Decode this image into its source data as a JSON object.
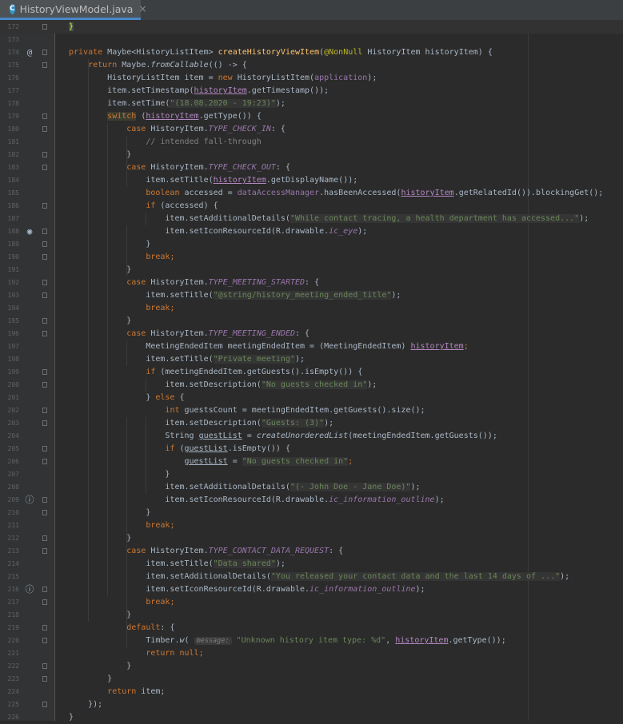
{
  "tab": {
    "icon_letter": "C",
    "title": "HistoryViewModel.java",
    "close": "×"
  },
  "lines": [
    {
      "n": "172",
      "tokens": [
        {
          "t": "}",
          "c": "brace-hl"
        }
      ]
    },
    {
      "n": "173",
      "tokens": []
    },
    {
      "n": "174",
      "marker": "@",
      "tokens": [
        {
          "t": "private ",
          "c": "k"
        },
        {
          "t": "Maybe<HistoryListItem> "
        },
        {
          "t": "createHistoryViewItem",
          "c": "m"
        },
        {
          "t": "("
        },
        {
          "t": "@NonNull ",
          "c": "an"
        },
        {
          "t": "HistoryItem historyItem) {"
        }
      ]
    },
    {
      "n": "175",
      "tokens": [
        {
          "t": "    "
        },
        {
          "t": "return ",
          "c": "k"
        },
        {
          "t": "Maybe."
        },
        {
          "t": "fromCallable",
          "c": "i"
        },
        {
          "t": "(() -> {"
        }
      ]
    },
    {
      "n": "176",
      "tokens": [
        {
          "t": "        HistoryListItem item = "
        },
        {
          "t": "new ",
          "c": "k"
        },
        {
          "t": "HistoryListItem("
        },
        {
          "t": "application",
          "c": "p"
        },
        {
          "t": ");"
        }
      ]
    },
    {
      "n": "177",
      "tokens": [
        {
          "t": "        item.setTimestamp("
        },
        {
          "t": "historyItem",
          "c": "uv"
        },
        {
          "t": ".getTimestamp());"
        }
      ]
    },
    {
      "n": "178",
      "tokens": [
        {
          "t": "        item.setTime("
        },
        {
          "t": "\"(18.08.2020 - 19:23)\"",
          "c": "s-hl"
        },
        {
          "t": ");"
        }
      ]
    },
    {
      "n": "179",
      "tokens": [
        {
          "t": "        "
        },
        {
          "t": "switch",
          "c": "k sw"
        },
        {
          "t": " ("
        },
        {
          "t": "historyItem",
          "c": "uv"
        },
        {
          "t": ".getType()) {"
        }
      ]
    },
    {
      "n": "180",
      "tokens": [
        {
          "t": "            "
        },
        {
          "t": "case ",
          "c": "k"
        },
        {
          "t": "HistoryItem."
        },
        {
          "t": "TYPE_CHECK_IN",
          "c": "p i"
        },
        {
          "t": ": {"
        }
      ]
    },
    {
      "n": "181",
      "tokens": [
        {
          "t": "                "
        },
        {
          "t": "// intended fall-through",
          "c": "cm"
        }
      ]
    },
    {
      "n": "182",
      "tokens": [
        {
          "t": "            }"
        }
      ]
    },
    {
      "n": "183",
      "tokens": [
        {
          "t": "            "
        },
        {
          "t": "case ",
          "c": "k"
        },
        {
          "t": "HistoryItem."
        },
        {
          "t": "TYPE_CHECK_OUT",
          "c": "p i"
        },
        {
          "t": ": {"
        }
      ]
    },
    {
      "n": "184",
      "tokens": [
        {
          "t": "                item.setTitle("
        },
        {
          "t": "historyItem",
          "c": "uv"
        },
        {
          "t": ".getDisplayName());"
        }
      ]
    },
    {
      "n": "185",
      "tokens": [
        {
          "t": "                "
        },
        {
          "t": "boolean ",
          "c": "k"
        },
        {
          "t": "accessed = "
        },
        {
          "t": "dataAccessManager",
          "c": "p"
        },
        {
          "t": ".hasBeenAccessed("
        },
        {
          "t": "historyItem",
          "c": "uv"
        },
        {
          "t": ".getRelatedId()).blockingGet();"
        }
      ]
    },
    {
      "n": "186",
      "tokens": [
        {
          "t": "                "
        },
        {
          "t": "if ",
          "c": "k"
        },
        {
          "t": "(accessed) {"
        }
      ]
    },
    {
      "n": "187",
      "tokens": [
        {
          "t": "                    item.setAdditionalDetails("
        },
        {
          "t": "\"While contact tracing, a health department has accessed...\"",
          "c": "s-hl"
        },
        {
          "t": ");"
        }
      ]
    },
    {
      "n": "188",
      "marker": "👁",
      "tokens": [
        {
          "t": "                    item.setIconResourceId(R.drawable."
        },
        {
          "t": "ic_eye",
          "c": "p i"
        },
        {
          "t": ");"
        }
      ]
    },
    {
      "n": "189",
      "tokens": [
        {
          "t": "                }"
        }
      ]
    },
    {
      "n": "190",
      "tokens": [
        {
          "t": "                "
        },
        {
          "t": "break",
          "c": "k"
        },
        {
          "t": ";",
          "c": "k"
        }
      ]
    },
    {
      "n": "191",
      "tokens": [
        {
          "t": "            }"
        }
      ]
    },
    {
      "n": "192",
      "tokens": [
        {
          "t": "            "
        },
        {
          "t": "case ",
          "c": "k"
        },
        {
          "t": "HistoryItem."
        },
        {
          "t": "TYPE_MEETING_STARTED",
          "c": "p i"
        },
        {
          "t": ": {"
        }
      ]
    },
    {
      "n": "193",
      "tokens": [
        {
          "t": "                item.setTitle("
        },
        {
          "t": "\"@string/history_meeting_ended_title\"",
          "c": "s-hl"
        },
        {
          "t": ");"
        }
      ]
    },
    {
      "n": "194",
      "tokens": [
        {
          "t": "                "
        },
        {
          "t": "break",
          "c": "k"
        },
        {
          "t": ";",
          "c": "k"
        }
      ]
    },
    {
      "n": "195",
      "tokens": [
        {
          "t": "            }"
        }
      ]
    },
    {
      "n": "196",
      "tokens": [
        {
          "t": "            "
        },
        {
          "t": "case ",
          "c": "k"
        },
        {
          "t": "HistoryItem."
        },
        {
          "t": "TYPE_MEETING_ENDED",
          "c": "p i"
        },
        {
          "t": ": {"
        }
      ]
    },
    {
      "n": "197",
      "tokens": [
        {
          "t": "                MeetingEndedItem meetingEndedItem = (MeetingEndedItem) "
        },
        {
          "t": "historyItem",
          "c": "uv"
        },
        {
          "t": ";",
          "c": "k"
        }
      ]
    },
    {
      "n": "198",
      "tokens": [
        {
          "t": "                item.setTitle("
        },
        {
          "t": "\"Private meeting\"",
          "c": "s-hl"
        },
        {
          "t": ");"
        }
      ]
    },
    {
      "n": "199",
      "tokens": [
        {
          "t": "                "
        },
        {
          "t": "if ",
          "c": "k"
        },
        {
          "t": "(meetingEndedItem.getGuests().isEmpty()) {"
        }
      ]
    },
    {
      "n": "200",
      "tokens": [
        {
          "t": "                    item.setDescription("
        },
        {
          "t": "\"No guests checked in\"",
          "c": "s-hl"
        },
        {
          "t": ");"
        }
      ]
    },
    {
      "n": "201",
      "tokens": [
        {
          "t": "                } "
        },
        {
          "t": "else ",
          "c": "k"
        },
        {
          "t": "{"
        }
      ]
    },
    {
      "n": "202",
      "tokens": [
        {
          "t": "                    "
        },
        {
          "t": "int ",
          "c": "k"
        },
        {
          "t": "guestsCount = meetingEndedItem.getGuests().size();"
        }
      ]
    },
    {
      "n": "203",
      "tokens": [
        {
          "t": "                    item.setDescription("
        },
        {
          "t": "\"Guests: (3)\"",
          "c": "s-hl"
        },
        {
          "t": ");"
        }
      ]
    },
    {
      "n": "204",
      "tokens": [
        {
          "t": "                    String "
        },
        {
          "t": "guestList",
          "c": "u"
        },
        {
          "t": " = "
        },
        {
          "t": "createUnorderedList",
          "c": "i"
        },
        {
          "t": "(meetingEndedItem.getGuests());"
        }
      ]
    },
    {
      "n": "205",
      "tokens": [
        {
          "t": "                    "
        },
        {
          "t": "if ",
          "c": "k"
        },
        {
          "t": "("
        },
        {
          "t": "guestList",
          "c": "u"
        },
        {
          "t": ".isEmpty()) {"
        }
      ]
    },
    {
      "n": "206",
      "tokens": [
        {
          "t": "                        "
        },
        {
          "t": "guestList",
          "c": "u"
        },
        {
          "t": " = "
        },
        {
          "t": "\"No guests checked in\"",
          "c": "s-hl"
        },
        {
          "t": ";",
          "c": "k"
        }
      ]
    },
    {
      "n": "207",
      "tokens": [
        {
          "t": "                    }"
        }
      ]
    },
    {
      "n": "208",
      "tokens": [
        {
          "t": "                    item.setAdditionalDetails("
        },
        {
          "t": "\"(- John Doe - Jane Doe)\"",
          "c": "s-hl"
        },
        {
          "t": ");"
        }
      ]
    },
    {
      "n": "209",
      "marker": "ⓘ",
      "tokens": [
        {
          "t": "                    item.setIconResourceId(R.drawable."
        },
        {
          "t": "ic_information_outline",
          "c": "p i"
        },
        {
          "t": ");"
        }
      ]
    },
    {
      "n": "210",
      "tokens": [
        {
          "t": "                }"
        }
      ]
    },
    {
      "n": "211",
      "tokens": [
        {
          "t": "                "
        },
        {
          "t": "break",
          "c": "k"
        },
        {
          "t": ";",
          "c": "k"
        }
      ]
    },
    {
      "n": "212",
      "tokens": [
        {
          "t": "            }"
        }
      ]
    },
    {
      "n": "213",
      "tokens": [
        {
          "t": "            "
        },
        {
          "t": "case ",
          "c": "k"
        },
        {
          "t": "HistoryItem."
        },
        {
          "t": "TYPE_CONTACT_DATA_REQUEST",
          "c": "p i"
        },
        {
          "t": ": {"
        }
      ]
    },
    {
      "n": "214",
      "tokens": [
        {
          "t": "                item.setTitle("
        },
        {
          "t": "\"Data shared\"",
          "c": "s-hl"
        },
        {
          "t": ");"
        }
      ]
    },
    {
      "n": "215",
      "tokens": [
        {
          "t": "                item.setAdditionalDetails("
        },
        {
          "t": "\"You released your contact data and the last 14 days of ...\"",
          "c": "s-hl"
        },
        {
          "t": ");"
        }
      ]
    },
    {
      "n": "216",
      "marker": "ⓘ",
      "tokens": [
        {
          "t": "                item.setIconResourceId(R.drawable."
        },
        {
          "t": "ic_information_outline",
          "c": "p i"
        },
        {
          "t": ");"
        }
      ]
    },
    {
      "n": "217",
      "tokens": [
        {
          "t": "                "
        },
        {
          "t": "break",
          "c": "k"
        },
        {
          "t": ";",
          "c": "k"
        }
      ]
    },
    {
      "n": "218",
      "tokens": [
        {
          "t": "            }"
        }
      ]
    },
    {
      "n": "219",
      "tokens": [
        {
          "t": "            "
        },
        {
          "t": "default",
          "c": "k"
        },
        {
          "t": ": {"
        }
      ]
    },
    {
      "n": "220",
      "tokens": [
        {
          "t": "                Timber."
        },
        {
          "t": "w",
          "c": "i"
        },
        {
          "t": "( "
        },
        {
          "t": "message:",
          "c": "hint"
        },
        {
          "t": " "
        },
        {
          "t": "\"Unknown history item type: %d\"",
          "c": "s"
        },
        {
          "t": ", "
        },
        {
          "t": "historyItem",
          "c": "uv"
        },
        {
          "t": ".getType());"
        }
      ]
    },
    {
      "n": "221",
      "tokens": [
        {
          "t": "                "
        },
        {
          "t": "return null",
          "c": "k"
        },
        {
          "t": ";",
          "c": "k"
        }
      ]
    },
    {
      "n": "222",
      "tokens": [
        {
          "t": "            }"
        }
      ]
    },
    {
      "n": "223",
      "tokens": [
        {
          "t": "        }"
        }
      ]
    },
    {
      "n": "224",
      "tokens": [
        {
          "t": "        "
        },
        {
          "t": "return ",
          "c": "k"
        },
        {
          "t": "item;"
        }
      ]
    },
    {
      "n": "225",
      "tokens": [
        {
          "t": "    });"
        }
      ]
    },
    {
      "n": "226",
      "tokens": [
        {
          "t": "}"
        }
      ]
    }
  ]
}
